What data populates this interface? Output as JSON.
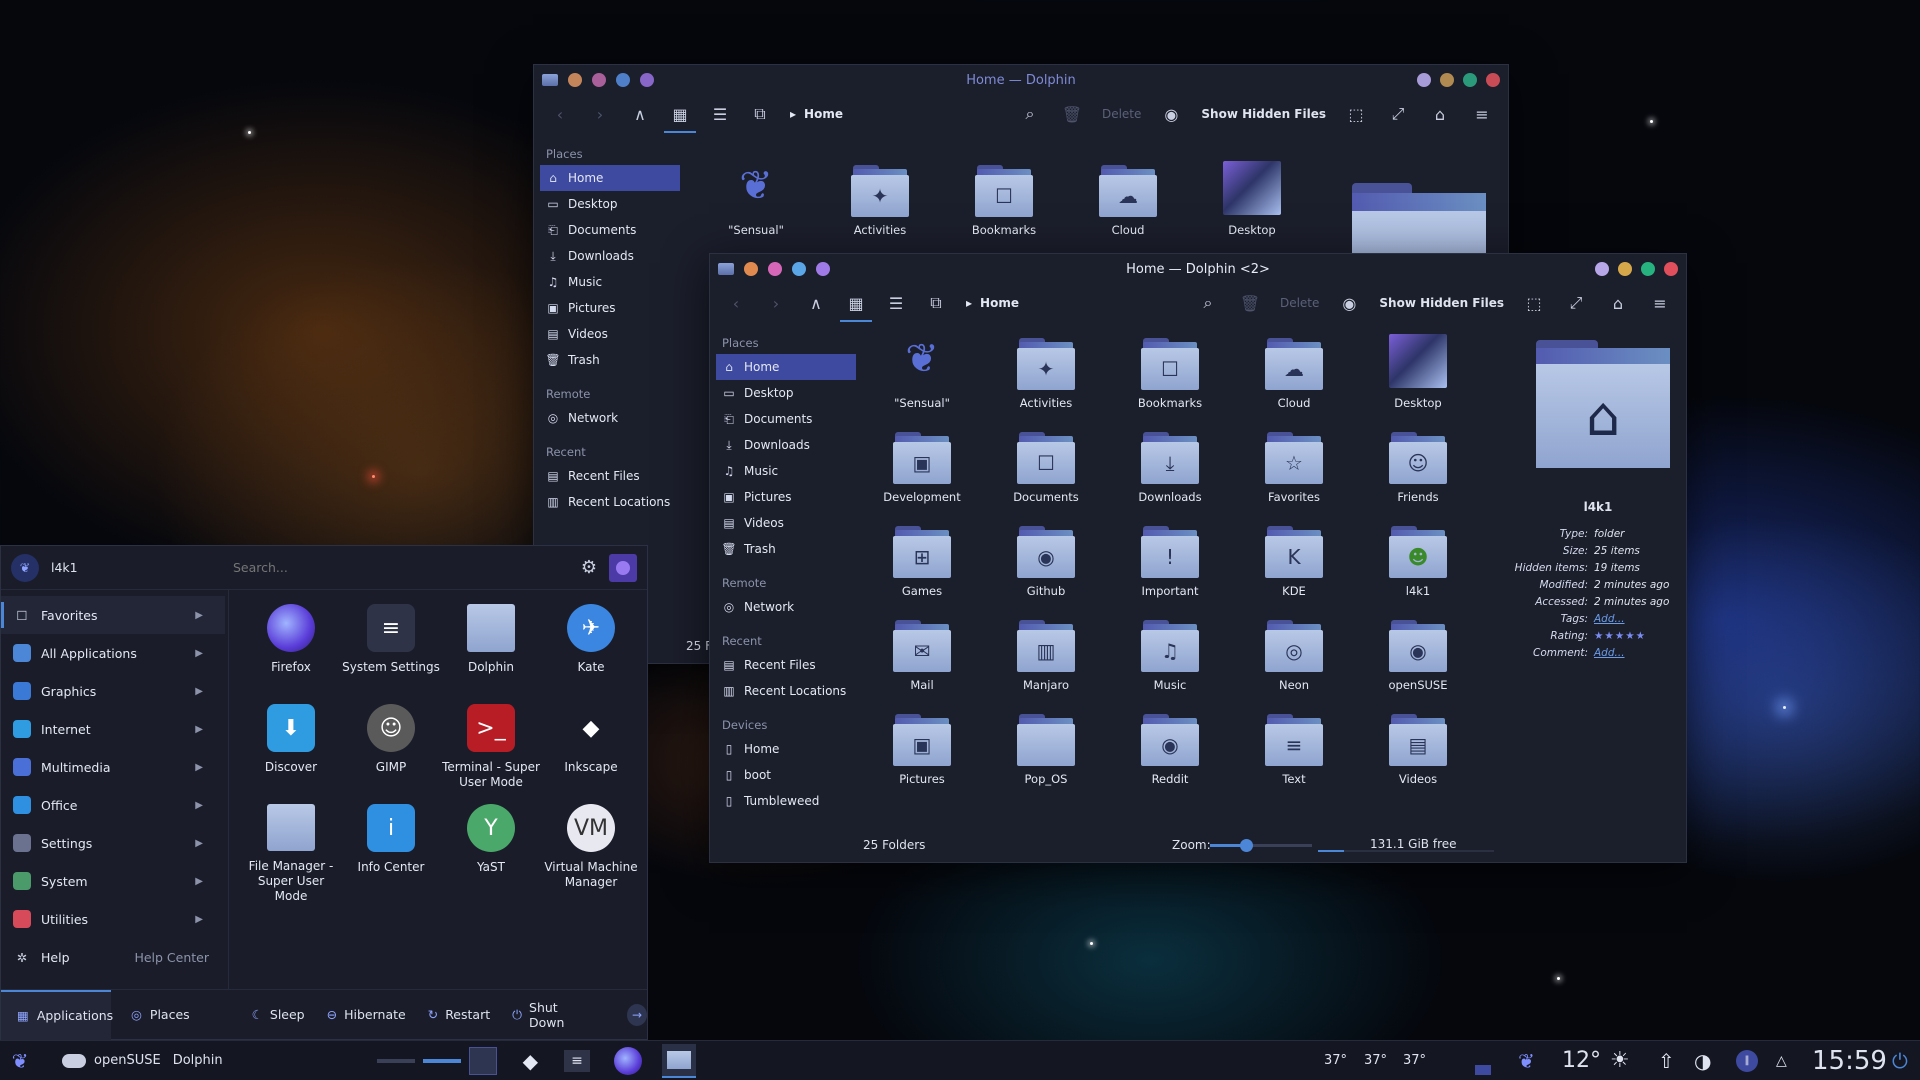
{
  "back_window": {
    "title": "Home — Dolphin",
    "breadcrumb": "Home",
    "toolbar": {
      "delete": "Delete",
      "show_hidden": "Show Hidden Files"
    },
    "sidebar": {
      "places_head": "Places",
      "places": [
        "Home",
        "Desktop",
        "Documents",
        "Downloads",
        "Music",
        "Pictures",
        "Videos",
        "Trash"
      ],
      "remote_head": "Remote",
      "remote": [
        "Network"
      ],
      "recent_head": "Recent",
      "recent": [
        "Recent Files",
        "Recent Locations"
      ]
    },
    "items": [
      "\"Sensual\"",
      "Activities",
      "Bookmarks",
      "Cloud",
      "Desktop"
    ],
    "status_partial": "25 F"
  },
  "front_window": {
    "title": "Home — Dolphin <2>",
    "breadcrumb": "Home",
    "toolbar": {
      "delete": "Delete",
      "show_hidden": "Show Hidden Files"
    },
    "sidebar": {
      "places_head": "Places",
      "places": [
        "Home",
        "Desktop",
        "Documents",
        "Downloads",
        "Music",
        "Pictures",
        "Videos",
        "Trash"
      ],
      "remote_head": "Remote",
      "remote": [
        "Network"
      ],
      "recent_head": "Recent",
      "recent": [
        "Recent Files",
        "Recent Locations"
      ],
      "devices_head": "Devices",
      "devices": [
        "Home",
        "boot",
        "Tumbleweed"
      ]
    },
    "items": [
      "\"Sensual\"",
      "Activities",
      "Bookmarks",
      "Cloud",
      "Desktop",
      "Development",
      "Documents",
      "Downloads",
      "Favorites",
      "Friends",
      "Games",
      "Github",
      "Important",
      "KDE",
      "l4k1",
      "Mail",
      "Manjaro",
      "Music",
      "Neon",
      "openSUSE",
      "Pictures",
      "Pop_OS",
      "Reddit",
      "Text",
      "Videos"
    ],
    "info": {
      "name": "l4k1",
      "rows": [
        {
          "label": "Type:",
          "value": "folder"
        },
        {
          "label": "Size:",
          "value": "25 items"
        },
        {
          "label": "Hidden items:",
          "value": "19 items"
        },
        {
          "label": "Modified:",
          "value": "2 minutes ago"
        },
        {
          "label": "Accessed:",
          "value": "2 minutes ago"
        },
        {
          "label": "Tags:",
          "value": "Add..."
        },
        {
          "label": "Rating:",
          "value": "★★★★★"
        },
        {
          "label": "Comment:",
          "value": "Add..."
        }
      ]
    },
    "status": {
      "count": "25 Folders",
      "zoom_label": "Zoom:",
      "zoom_level": 0.35,
      "free": "131.1 GiB free",
      "free_fraction": 0.15
    }
  },
  "launcher": {
    "user": "l4k1",
    "search_placeholder": "Search...",
    "categories": [
      "Favorites",
      "All Applications",
      "Graphics",
      "Internet",
      "Multimedia",
      "Office",
      "Settings",
      "System",
      "Utilities",
      "Help"
    ],
    "help_right": "Help Center",
    "apps": [
      "Firefox",
      "System Settings",
      "Dolphin",
      "Kate",
      "Discover",
      "GIMP",
      "Terminal - Super User Mode",
      "Inkscape",
      "File Manager - Super User Mode",
      "Info Center",
      "YaST",
      "Virtual Machine Manager"
    ],
    "footer": {
      "applications": "Applications",
      "places": "Places",
      "sleep": "Sleep",
      "hibernate": "Hibernate",
      "restart": "Restart",
      "shutdown": "Shut Down"
    }
  },
  "panel": {
    "task1": "openSUSE",
    "task2": "Dolphin",
    "temps": [
      "37°",
      "37°",
      "37°"
    ],
    "weather": "12°",
    "clock": "15:59"
  },
  "colors": {
    "accent": "#4c86d6",
    "selection": "#3e4aa0",
    "window_bg": "#1b1e2b",
    "folder": "#a8bbe0"
  }
}
